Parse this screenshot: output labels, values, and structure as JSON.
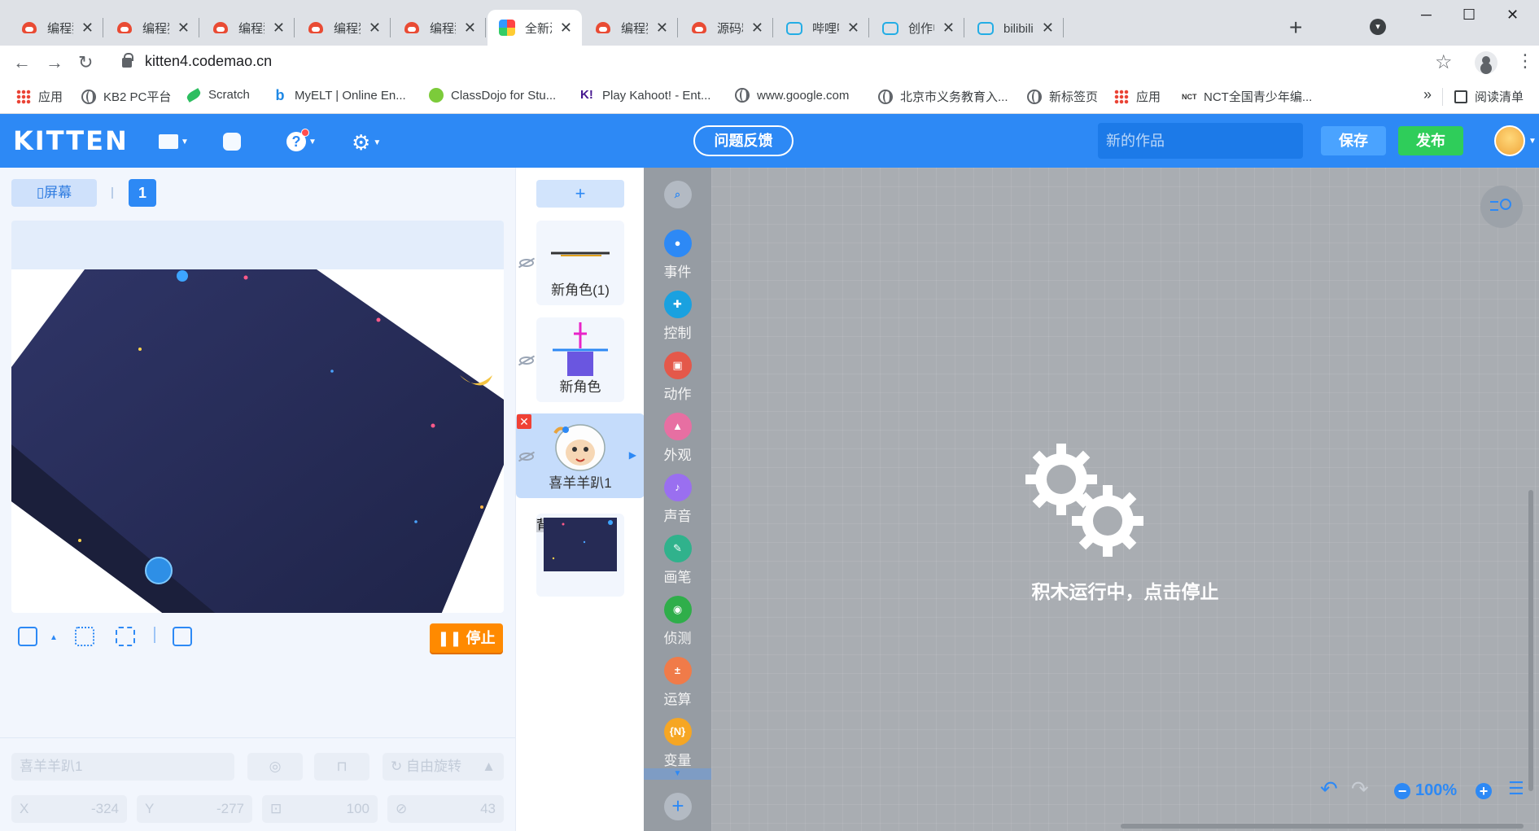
{
  "browser": {
    "tabs": [
      {
        "title": "编程猫社",
        "icon": "codemao-cat-icon",
        "active": false
      },
      {
        "title": "编程猫社",
        "icon": "codemao-cat-icon",
        "active": false
      },
      {
        "title": "编程猫社",
        "icon": "codemao-cat-icon",
        "active": false
      },
      {
        "title": "编程猫社",
        "icon": "codemao-cat-icon",
        "active": false
      },
      {
        "title": "编程猫社",
        "icon": "codemao-cat-icon",
        "active": false
      },
      {
        "title": "全新源码",
        "icon": "kitten-new-icon",
        "active": true
      },
      {
        "title": "编程猫社",
        "icon": "codemao-cat-icon",
        "active": false
      },
      {
        "title": "源码精灵",
        "icon": "codemao-cat-icon",
        "active": false
      },
      {
        "title": "哔哩哔哩",
        "icon": "bilibili-icon",
        "active": false
      },
      {
        "title": "创作中心",
        "icon": "bilibili-icon",
        "active": false
      },
      {
        "title": "bilibili云",
        "icon": "bilibili-icon",
        "active": false
      }
    ],
    "url": "kitten4.codemao.cn",
    "bookmarks": [
      {
        "label": "应用",
        "icon": "apps-grid-icon"
      },
      {
        "label": "KB2 PC平台",
        "icon": "globe-icon"
      },
      {
        "label": "Scratch",
        "icon": "scratch-icon"
      },
      {
        "label": "MyELT | Online En...",
        "icon": "bing-icon"
      },
      {
        "label": "ClassDojo for Stu...",
        "icon": "classdojo-icon"
      },
      {
        "label": "Play Kahoot! - Ent...",
        "icon": "kahoot-icon"
      },
      {
        "label": "www.google.com",
        "icon": "globe-icon"
      },
      {
        "label": "北京市义务教育入...",
        "icon": "globe-icon"
      },
      {
        "label": "新标签页",
        "icon": "globe-icon"
      },
      {
        "label": "应用",
        "icon": "apps-grid-icon"
      },
      {
        "label": "NCT全国青少年编...",
        "icon": "nct-icon"
      }
    ],
    "more_bookmarks": "»",
    "reading_list": "阅读清单"
  },
  "app": {
    "logo": "KITTEN",
    "feedback": "问题反馈",
    "work_name_placeholder": "新的作品",
    "save": "保存",
    "publish": "发布",
    "accent": "#2d89f5"
  },
  "stage": {
    "screen_label": "屏幕",
    "screen_number": "1",
    "stop": "停止"
  },
  "properties": {
    "name_placeholder": "喜羊羊趴1",
    "rotation_mode": "自由旋转",
    "x_label": "X",
    "x_value": "-324",
    "y_label": "Y",
    "y_value": "-277",
    "size_value": "100",
    "direction_value": "43"
  },
  "sprites": [
    {
      "name": "新角色(1)",
      "selected": false
    },
    {
      "name": "新角色",
      "selected": false
    },
    {
      "name": "喜羊羊趴1",
      "selected": true
    }
  ],
  "background_label": "背景",
  "categories": [
    {
      "label": "事件",
      "color": "#2d89f5"
    },
    {
      "label": "控制",
      "color": "#1aa1e0"
    },
    {
      "label": "动作",
      "color": "#e4584a"
    },
    {
      "label": "外观",
      "color": "#e76fa2"
    },
    {
      "label": "声音",
      "color": "#9a6ff0"
    },
    {
      "label": "画笔",
      "color": "#30b28c"
    },
    {
      "label": "侦测",
      "color": "#2fae4a"
    },
    {
      "label": "运算",
      "color": "#f07b49"
    },
    {
      "label": "变量",
      "color": "#f6a623"
    }
  ],
  "workspace": {
    "running_message": "积木运行中，点击停止",
    "zoom": "100%"
  }
}
